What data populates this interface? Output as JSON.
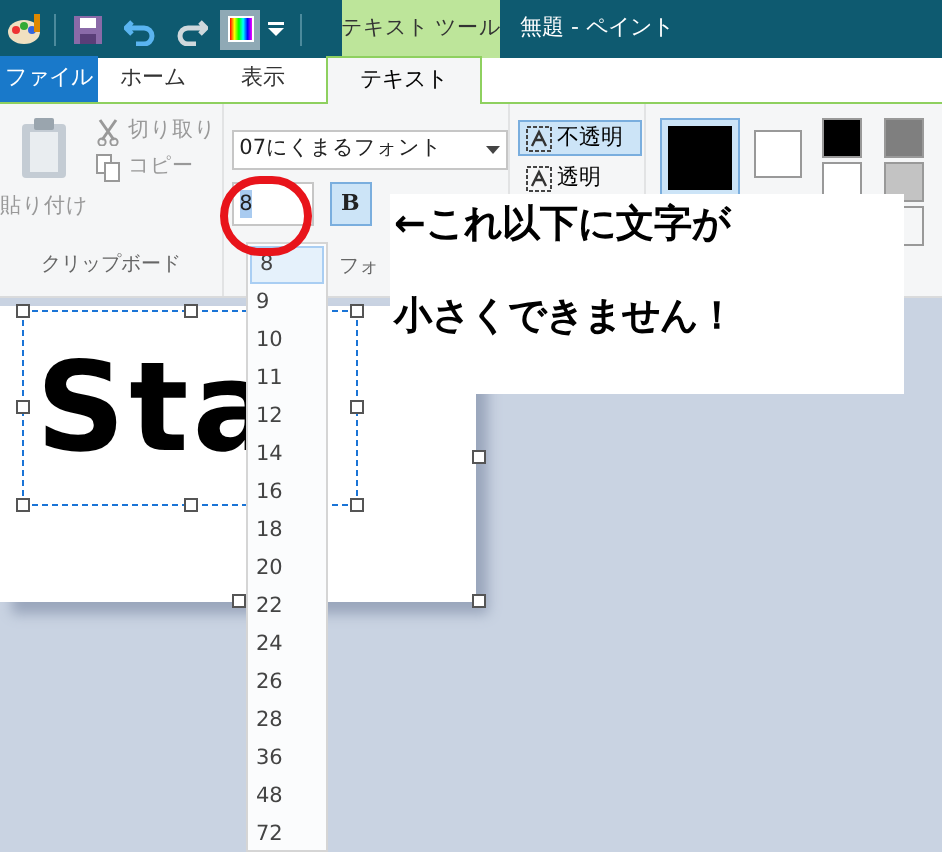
{
  "title_bar": {
    "context_tab": "テキスト ツール",
    "title": "無題 - ペイント"
  },
  "tabs": [
    {
      "label": "ファイル",
      "kind": "file",
      "selected": false
    },
    {
      "label": "ホーム",
      "kind": "tab",
      "selected": false
    },
    {
      "label": "表示",
      "kind": "tab",
      "selected": false
    },
    {
      "label": "テキスト",
      "kind": "tab",
      "selected": true
    }
  ],
  "clipboard": {
    "paste": "貼り付け",
    "cut": "切り取り",
    "copy": "コピー",
    "label": "クリップボード"
  },
  "font": {
    "family": "07にくまるフォント",
    "size": "8",
    "bold": "B",
    "label": "フォ"
  },
  "background": [
    {
      "label": "不透明",
      "selected": true
    },
    {
      "label": "透明",
      "selected": false
    }
  ],
  "canvas": {
    "text": "Sta"
  },
  "size_list": [
    {
      "label": "8",
      "selected": true
    },
    {
      "label": "9",
      "selected": false
    },
    {
      "label": "10",
      "selected": false
    },
    {
      "label": "11",
      "selected": false
    },
    {
      "label": "12",
      "selected": false
    },
    {
      "label": "14",
      "selected": false
    },
    {
      "label": "16",
      "selected": false
    },
    {
      "label": "18",
      "selected": false
    },
    {
      "label": "20",
      "selected": false
    },
    {
      "label": "22",
      "selected": false
    },
    {
      "label": "24",
      "selected": false
    },
    {
      "label": "26",
      "selected": false
    },
    {
      "label": "28",
      "selected": false
    },
    {
      "label": "36",
      "selected": false
    },
    {
      "label": "48",
      "selected": false
    },
    {
      "label": "72",
      "selected": false
    }
  ],
  "callout": [
    "←これ以下に文字が",
    "小さくできません！"
  ]
}
